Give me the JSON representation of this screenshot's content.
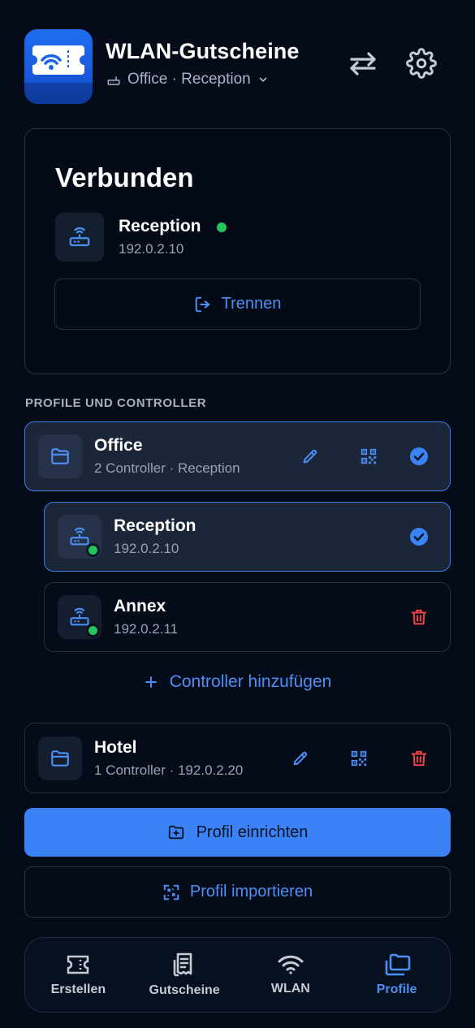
{
  "header": {
    "title": "WLAN-Gutscheine",
    "subtitle": "Office · Reception",
    "icons": {
      "app": "wifi-ticket-icon",
      "router": "router-icon",
      "swap": "swap-arrows-icon",
      "settings": "gear-icon",
      "dropdown": "chevron-down-icon"
    }
  },
  "connection": {
    "status": "Verbunden",
    "device_name": "Reception",
    "device_ip": "192.0.2.10",
    "disconnect_label": "Trennen"
  },
  "profiles": {
    "section_label": "PROFILE UND CONTROLLER",
    "items": [
      {
        "name": "Office",
        "meta": "2 Controller · Reception",
        "controllers": [
          {
            "name": "Reception",
            "ip": "192.0.2.10"
          },
          {
            "name": "Annex",
            "ip": "192.0.2.11"
          }
        ],
        "add_controller_label": "Controller hinzufügen"
      },
      {
        "name": "Hotel",
        "meta": "1 Controller · 192.0.2.20"
      }
    ]
  },
  "actions": {
    "setup_profile": "Profil einrichten",
    "import_profile": "Profil importieren"
  },
  "nav": {
    "items": [
      {
        "label": "Erstellen",
        "icon": "ticket-icon"
      },
      {
        "label": "Gutscheine",
        "icon": "receipt-icon"
      },
      {
        "label": "WLAN",
        "icon": "wifi-icon"
      },
      {
        "label": "Profile",
        "icon": "folders-icon"
      }
    ],
    "active": "Profile"
  },
  "colors": {
    "background": "#050b18",
    "accent": "#3b82f6",
    "success": "#22c55e",
    "danger": "#ef4444"
  }
}
